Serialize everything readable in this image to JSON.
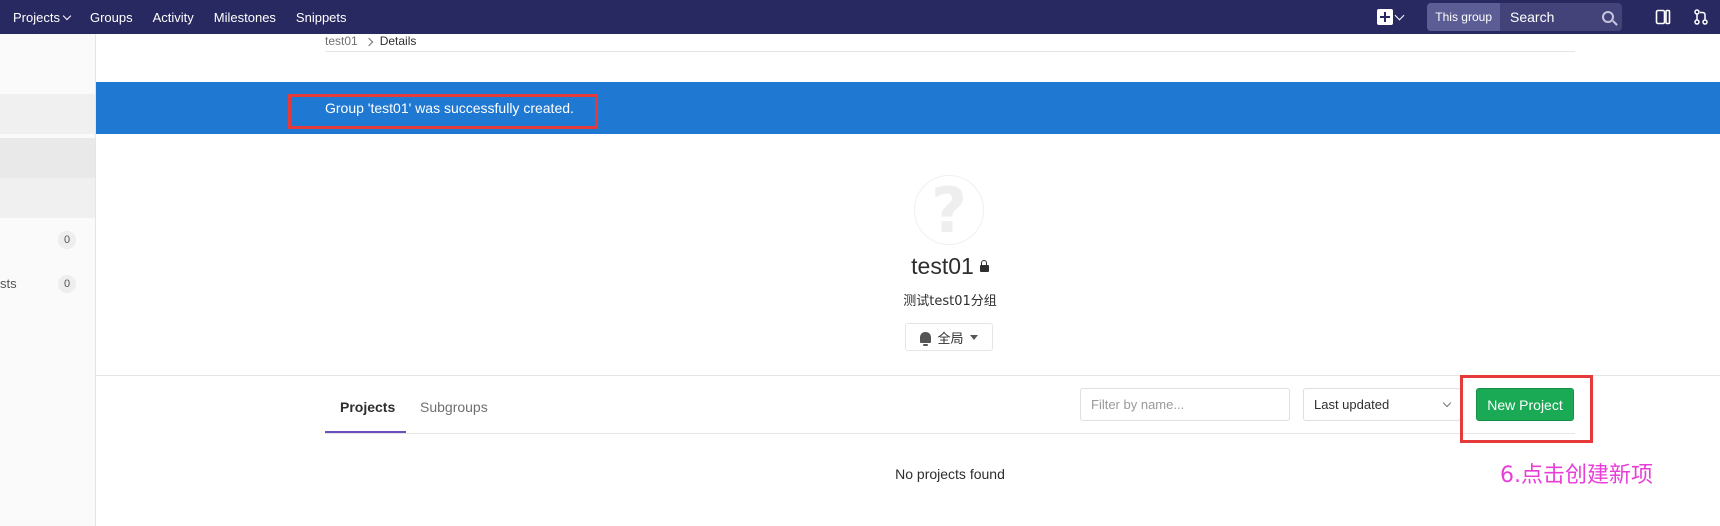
{
  "navbar": {
    "links": [
      "Projects",
      "Groups",
      "Activity",
      "Milestones",
      "Snippets"
    ],
    "search_scope": "This group",
    "search_placeholder": "Search",
    "icons": [
      "new-dropdown-icon",
      "search-icon",
      "todos-icon",
      "merge-requests-icon"
    ]
  },
  "sidebar": {
    "items": [
      {
        "label": "",
        "badge": "0"
      },
      {
        "label": "sts",
        "badge": "0"
      }
    ]
  },
  "breadcrumb": {
    "parent": "test01",
    "current": "Details"
  },
  "flash": {
    "message": "Group 'test01' was successfully created."
  },
  "group": {
    "avatar_glyph": "?",
    "name": "test01",
    "description": "测试test01分组",
    "notification_level": "全局"
  },
  "tabs": {
    "projects_label": "Projects",
    "subgroups_label": "Subgroups"
  },
  "controls": {
    "filter_placeholder": "Filter by name...",
    "sort_value": "Last updated",
    "new_project_label": "New Project"
  },
  "empty_message": "No projects found",
  "annotation": "6.点击创建新项",
  "colors": {
    "navbar": "#292961",
    "flash": "#1f78d1",
    "primary_button": "#1aaa55",
    "highlight_box": "#e63a3a",
    "annotation": "#e83ed8"
  }
}
